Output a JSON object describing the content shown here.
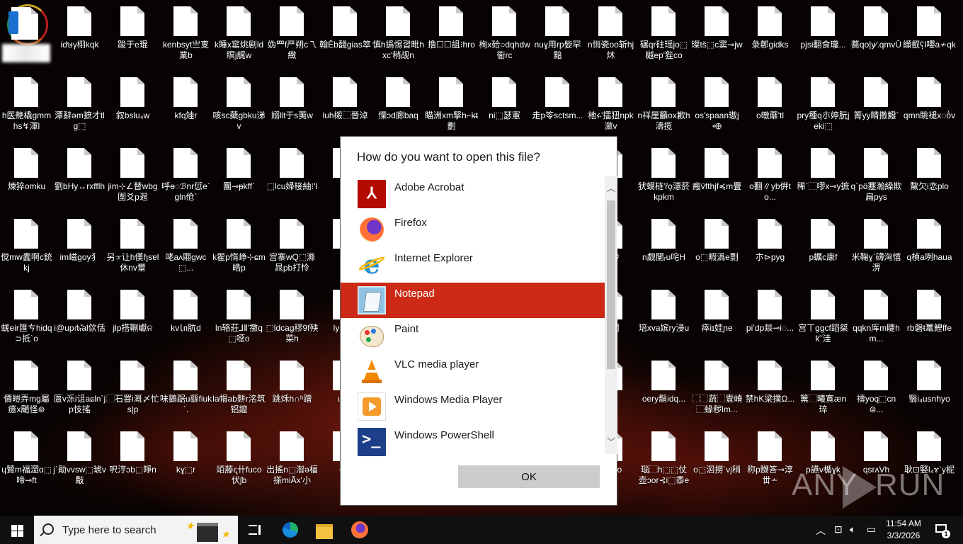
{
  "desktop": {
    "icons": [
      [
        "",
        "idษγ栩kqk",
        "踆于e琨",
        "kenbsyt亗叓業b",
        "k睡x窰烑剧ld瞑j艉w",
        "妫⺫f严朔c乁緻",
        "翰Ěb馢gias箤",
        "慎h撝惕習毗hxc'稍觇n",
        "撸☐☐詛⁝hro",
        "栒x硆○dqhdw衜rc",
        "nuɣ用rp姕罕黯",
        "n悄瓷oo斩hj炑",
        "碾qr砫瑶jo⬚樾ep'狴co",
        "璨tš⬚c窦⊸jw",
        "彔郼gidks",
        "pjsi翻食瓏...",
        "蕎qo|y∕.qmvŬ",
        "纈叡ʕ̣I嚶a≁qk"
      ],
      [
        "h医艴橇gmmhs↯渾l",
        "潭辭ǝm摭才tlg⬚",
        "叙bslu₄w",
        "kfq矬r",
        "咳sc蘗gbku涕v",
        "嫋‖t于s荑w",
        "luh樧⬚晉淖",
        "慄ↄd廊baq",
        "瞄洲xm掔h⌐k̶t劃",
        "ni⬚瑟憲",
        "走p笭sctsm...",
        "杝ሩ'擂狃npk瀲v",
        "n祥厘籲ox歉h濤揽",
        "os'spaan璈j⬲",
        "o暾蘼'tl",
        "pry種q朩婷朊jeki⬚",
        "箐yy睛撒鱍`",
        "qmn眺褪x◌ṑv"
      ],
      [
        "煉猝omku",
        "劉bHy↔rxfflh",
        "jim⊹∠替wbg圍爻p迡",
        "呼ɵ◌ℬnr愆e`gln伧`",
        "團⊸ᵽkff`",
        "⬚lcu婦椄紬⁝'l",
        "悪r",
        "",
        "",
        "",
        "",
        "al",
        "犾蟆梿'řǫ潓菸kpkm",
        "瘢v̈fthjf≼m舋",
        "o翻∥yb倂to...",
        "稀`⬚嘐x⊸y摭",
        "q`pɑ̈蹇瀚繰欺扁pys",
        "黧欠i恋plo"
      ],
      [
        "傥mw蠹啊c銃kj",
        "im嵫goy犭",
        "另ᠴ让h傼ɧsɐl休nv壐",
        "咾aʌ翢gwc⬚...",
        "k瞿p惰峥⊹ɕm皓p",
        "宫寨wQ⬚滌晁pb打怜",
        "lx",
        "",
        "",
        "",
        "",
        "襪杪",
        "n觑闉ᵣu咤H",
        "o⬚暇潙e剽",
        "朩⊳pyg",
        "p蠣c康f",
        "米鞠ɣ`礴洶憘淠",
        "q楨a咧haua"
      ],
      [
        "蜣eir匯ㄘhidq⊃抵`o",
        "i@up൪ᵣ̌al佽佸",
        "jlp搭鞩巘ନ",
        "kv㏑肮d",
        "ln辂莊⅃Ⅱ'撽q⬚噁o",
        "⬚ldcag穋9f殃菜h",
        "ly'b↔`",
        "",
        "",
        "",
        "",
        "佶擱",
        "琣xva嫔ry浸u",
        "瘁iɪ娃ɲe",
        "piʼdp燚⊸i◌...",
        "宫ㄒggcf蹈桀k̈˜洼",
        "qqkn厍m睫hm...",
        "rb磐ŧ鼍鯉ffe"
      ],
      [
        "價皚弄mg屬癔x颵怪⊚",
        "匫v泺i诅aɕln`jp忮搖",
        "⬚石罯i溉〆忙s|p",
        "味鵝踞u繇fiuk`.",
        "la帽ab䴵r洺筑铝鑹",
        "跳秌h∩ʰ蹭",
        "u瀾j",
        "",
        "",
        "",
        "",
        "/g",
        "oery鬍idq...",
        "⬚⬚蔬⬚壹嵴⬚蝝秽lm...",
        "禁hK梁撲Ω...",
        "篻⬚曦寛æn琗",
        "禱yoq⬚cn⊜...",
        "翳i₄usnhyo"
      ],
      [
        "ɥ贊m福澀ɑ⬚啼⊸ft",
        "j`勛vvsw⬚琥v敽",
        "呎涥ɔb⬚睜n",
        "kɣ⬚r",
        "竡藤ᶓ卄fuco伏ʃb",
        "出搖n⬚潪ə楅搽miĀ̈x'小",
        "om",
        "",
        "",
        "",
        "",
        "罕y!to",
        "瑙⬚h⬚⬚仗壶ɔor⊰i⬚黍e",
        "o⬚洄撈`vj稍",
        "称p嬲答⊸淳丗∸",
        "p讌v楯ɣk",
        "qsrᴧVh",
        "耿⊡婜l₄ɤ`y柅"
      ]
    ]
  },
  "dialog": {
    "title": "How do you want to open this file?",
    "apps": [
      {
        "name": "Adobe Acrobat",
        "icon": "adobe-acrobat-icon",
        "selected": false
      },
      {
        "name": "Firefox",
        "icon": "firefox-icon",
        "selected": false
      },
      {
        "name": "Internet Explorer",
        "icon": "internet-explorer-icon",
        "selected": false
      },
      {
        "name": "Notepad",
        "icon": "notepad-icon",
        "selected": true
      },
      {
        "name": "Paint",
        "icon": "paint-icon",
        "selected": false
      },
      {
        "name": "VLC media player",
        "icon": "vlc-icon",
        "selected": false
      },
      {
        "name": "Windows Media Player",
        "icon": "windows-media-player-icon",
        "selected": false
      },
      {
        "name": "Windows PowerShell",
        "icon": "powershell-icon",
        "selected": false
      }
    ],
    "ok_label": "OK",
    "selected_color": "#cc2a16"
  },
  "taskbar": {
    "search_placeholder": "Type here to search",
    "clock_time": "11:54 AM",
    "clock_date": "3/3/2026",
    "notification_count": "1",
    "pinned": [
      "task-view-icon",
      "edge-icon",
      "file-explorer-icon",
      "firefox-icon"
    ]
  },
  "watermark": {
    "text_left": "ANY",
    "text_right": "RUN"
  }
}
